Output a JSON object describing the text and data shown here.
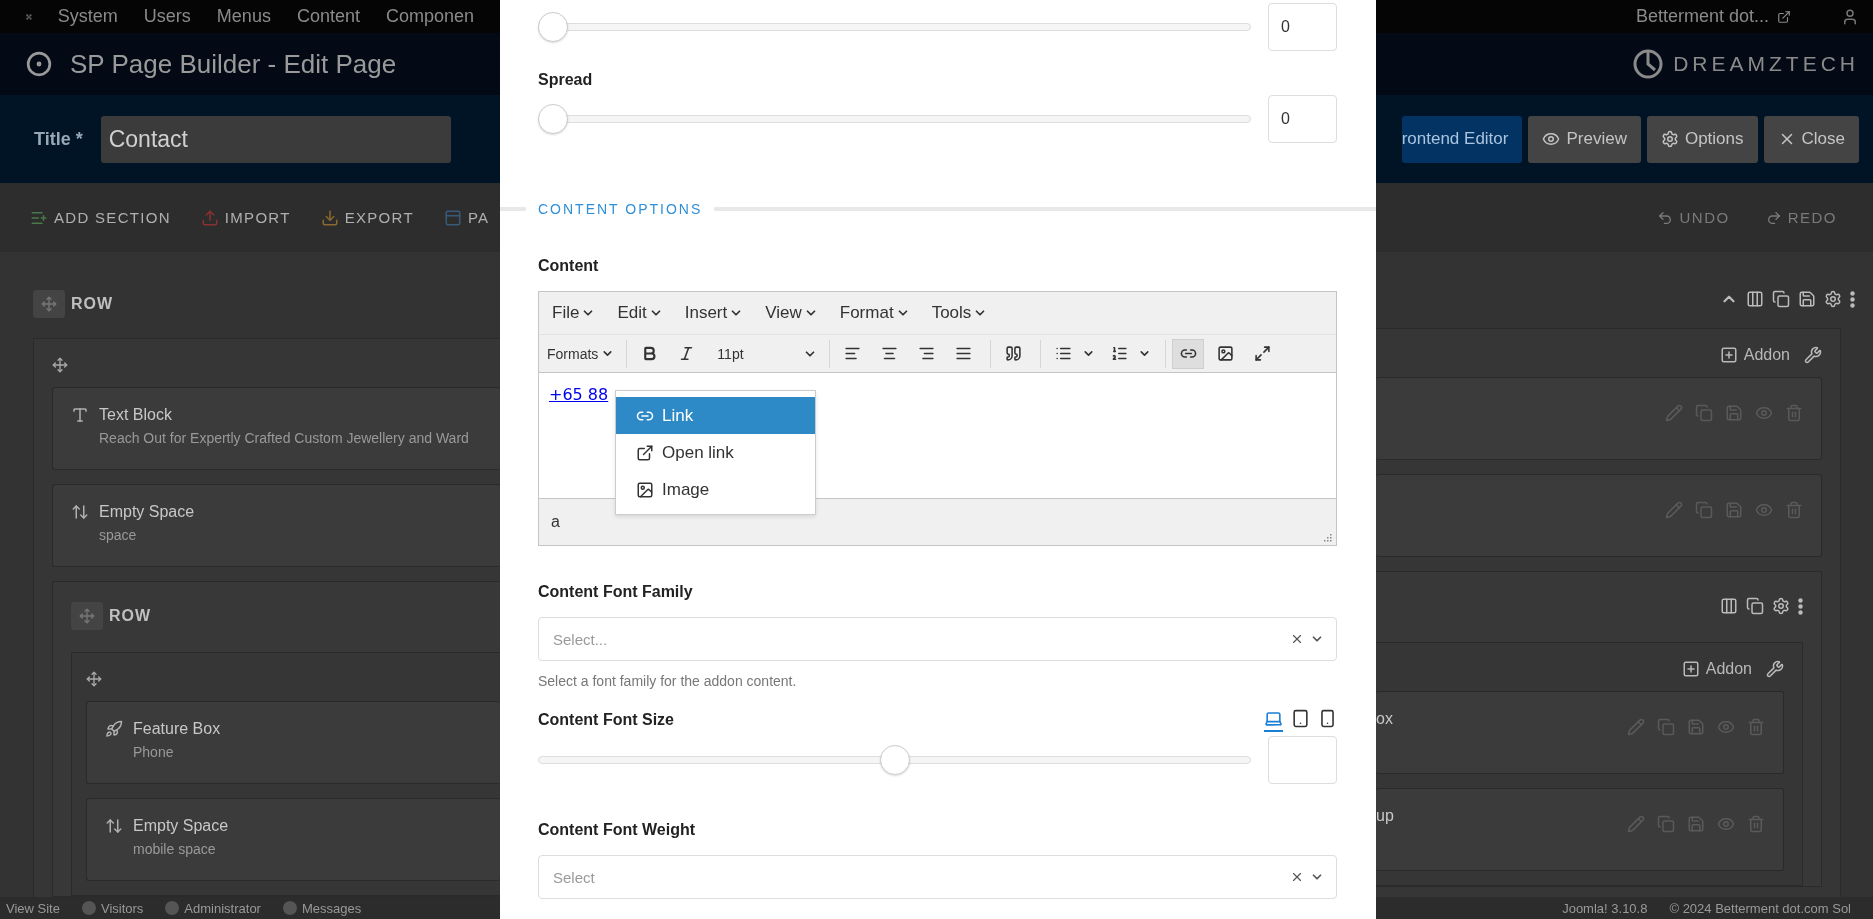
{
  "topnav": {
    "menu": [
      "System",
      "Users",
      "Menus",
      "Content",
      "Componen"
    ],
    "site": "Betterment dot..."
  },
  "header": {
    "title": "SP Page Builder - Edit Page",
    "brand": "DREAMZTECH"
  },
  "titlebar": {
    "label": "Title *",
    "value": "Contact",
    "buttons": [
      {
        "label": "rontend Editor",
        "kind": "frontend"
      },
      {
        "label": "Preview",
        "kind": "preview"
      },
      {
        "label": "Options",
        "kind": "options"
      },
      {
        "label": "Close",
        "kind": "close"
      }
    ]
  },
  "toolbar": {
    "actions": [
      {
        "label": "ADD SECTION",
        "kind": "add"
      },
      {
        "label": "IMPORT",
        "kind": "import"
      },
      {
        "label": "EXPORT",
        "kind": "export"
      },
      {
        "label": "PA",
        "kind": "page"
      }
    ],
    "history": [
      {
        "label": "UNDO",
        "kind": "undo",
        "disabled": true
      },
      {
        "label": "REDO",
        "kind": "redo",
        "disabled": true
      }
    ]
  },
  "builder": {
    "label": "ROW",
    "addon_button": "Addon",
    "addons": [
      {
        "kind": "text",
        "title": "Text Block",
        "subtitle": "Reach Out for Expertly Crafted Custom Jewellery and Ward"
      },
      {
        "kind": "space",
        "title": "Empty Space",
        "subtitle": "space"
      }
    ],
    "nested_row": {
      "label": "ROW",
      "columns": [
        {
          "addons": [
            {
              "kind": "feature",
              "title": "Feature Box",
              "subtitle": "Phone"
            },
            {
              "kind": "space",
              "title": "Empty Space",
              "subtitle": "mobile space"
            }
          ]
        },
        {
          "addon_button": "Addon",
          "addons": [
            {
              "title": "ox"
            },
            {
              "title": "up"
            }
          ]
        }
      ]
    }
  },
  "status_bar": {
    "left": [
      "View Site",
      "Visitors",
      "Administrator",
      "Messages"
    ],
    "right": [
      "Joomla! 3.10.8",
      "© 2024 Betterment dot.com Sol"
    ]
  },
  "modal": {
    "fields": [
      {
        "kind": "slider",
        "level": 0,
        "value": "0"
      },
      {
        "kind": "slider",
        "label": "Spread",
        "level": 0,
        "value": "0"
      },
      {
        "kind": "section",
        "label": "CONTENT OPTIONS"
      },
      {
        "kind": "editor",
        "label": "Content",
        "editor": {
          "menus": [
            "File",
            "Edit",
            "Insert",
            "View",
            "Format",
            "Tools"
          ],
          "formats": "Formats",
          "font_size": "11pt",
          "tools": [
            {
              "kind": "bold",
              "active": false
            },
            {
              "kind": "italic",
              "active": false
            },
            {
              "kind": "left",
              "active": false
            },
            {
              "kind": "center",
              "active": false
            },
            {
              "kind": "right",
              "active": false
            },
            {
              "kind": "justify",
              "active": false
            },
            {
              "kind": "quote",
              "active": false
            },
            {
              "kind": "bullets",
              "active": false
            },
            {
              "kind": "numbers",
              "active": false
            },
            {
              "kind": "link",
              "active": true
            },
            {
              "kind": "image",
              "active": false
            },
            {
              "kind": "fullscreen",
              "active": false
            }
          ],
          "content_link": "+65 88",
          "path": "a",
          "context_menu": [
            {
              "label": "Link",
              "selected": true
            },
            {
              "label": "Open link",
              "selected": false
            },
            {
              "label": "Image",
              "selected": false
            }
          ]
        }
      },
      {
        "kind": "select",
        "label": "Content Font Family",
        "placeholder": "Select...",
        "help": "Select a font family for the addon content."
      },
      {
        "kind": "slider",
        "label": "Content Font Size",
        "level": 0.5,
        "devices": [
          {
            "kind": "desktop",
            "selected": true
          },
          {
            "kind": "tablet",
            "selected": false
          },
          {
            "kind": "mobile",
            "selected": false
          }
        ]
      },
      {
        "kind": "select",
        "label": "Content Font Weight",
        "placeholder": "Select"
      }
    ]
  }
}
